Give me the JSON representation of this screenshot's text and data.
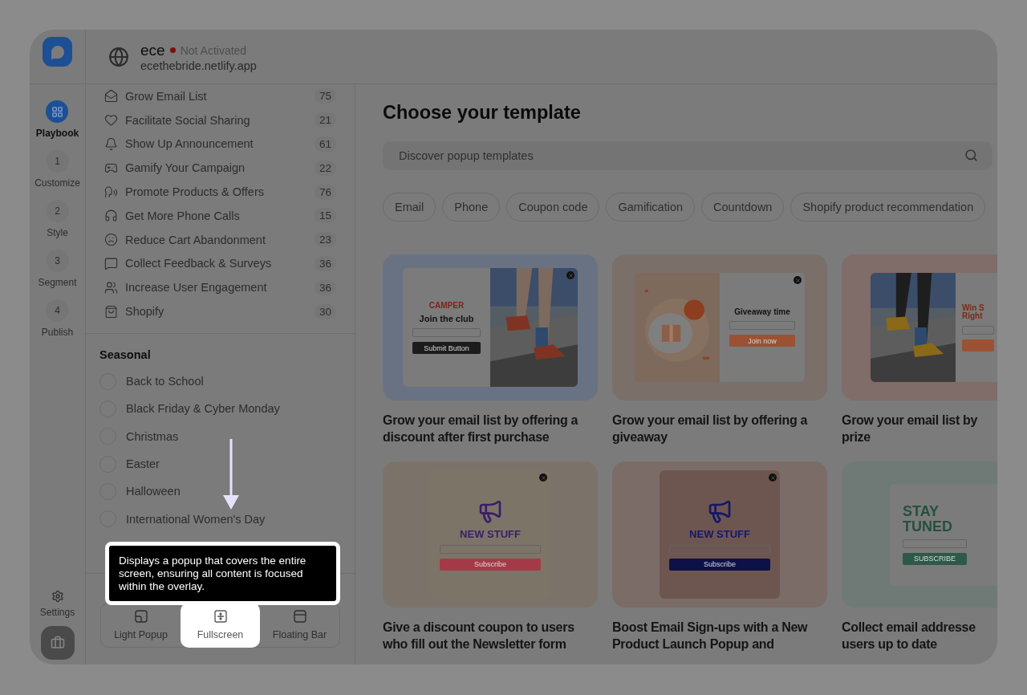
{
  "app": {
    "site_name": "ece",
    "status": "Not Activated",
    "domain": "ecethebride.netlify.app"
  },
  "rail": {
    "items": [
      {
        "kind": "icon",
        "label": "Playbook",
        "selected": true
      },
      {
        "kind": "step",
        "number": "1",
        "label": "Customize",
        "selected": false
      },
      {
        "kind": "step",
        "number": "2",
        "label": "Style",
        "selected": false
      },
      {
        "kind": "step",
        "number": "3",
        "label": "Segment",
        "selected": false
      },
      {
        "kind": "step",
        "number": "4",
        "label": "Publish",
        "selected": false
      }
    ],
    "settings": "Settings"
  },
  "goals": [
    {
      "label": "Grow Email List",
      "count": "75"
    },
    {
      "label": "Facilitate Social Sharing",
      "count": "21"
    },
    {
      "label": "Show Up Announcement",
      "count": "61"
    },
    {
      "label": "Gamify Your Campaign",
      "count": "22"
    },
    {
      "label": "Promote Products & Offers",
      "count": "76"
    },
    {
      "label": "Get More Phone Calls",
      "count": "15"
    },
    {
      "label": "Reduce Cart Abandonment",
      "count": "23"
    },
    {
      "label": "Collect Feedback & Surveys",
      "count": "36"
    },
    {
      "label": "Increase User Engagement",
      "count": "36"
    },
    {
      "label": "Shopify",
      "count": "30"
    }
  ],
  "seasonal": {
    "title": "Seasonal",
    "items": [
      {
        "label": "Back to School",
        "checked": false
      },
      {
        "label": "Black Friday & Cyber Monday",
        "checked": false
      },
      {
        "label": "Christmas",
        "checked": false
      },
      {
        "label": "Easter",
        "checked": false
      },
      {
        "label": "Halloween",
        "checked": false
      },
      {
        "label": "International Women's Day",
        "checked": false
      }
    ]
  },
  "popup_type": {
    "options": [
      {
        "label": "Light Popup",
        "selected": false
      },
      {
        "label": "Fullscreen",
        "selected": true
      },
      {
        "label": "Floating Bar",
        "selected": false
      }
    ]
  },
  "tooltip": "Displays a popup that covers the entire screen, ensuring all content is focused within the overlay.",
  "main": {
    "title": "Choose your template",
    "search": {
      "placeholder": "Discover popup templates"
    },
    "chips": [
      "Email",
      "Phone",
      "Coupon code",
      "Gamification",
      "Countdown",
      "Shopify product recommendation"
    ],
    "templates": [
      {
        "title": "Grow your email list by offering a\ndiscount after first purchase",
        "color": "#697282",
        "preview": {
          "kind": "photo-right",
          "brand": "CAMPER",
          "headline": "Join the club",
          "button": "Submit Button"
        }
      },
      {
        "title": "Grow your email list by offering a\ngiveaway",
        "color": "#7a6f69",
        "preview": {
          "kind": "photo-left",
          "headline": "Giveaway time",
          "button": "Join now"
        }
      },
      {
        "title": "Grow your email list by\nprize",
        "color": "#806c69",
        "preview": {
          "kind": "photo-left",
          "headline": "Win S\nRight"
        }
      },
      {
        "title": "Give a discount coupon to users\nwho fill out the Newsletter form",
        "color": "#7b7369",
        "preview": {
          "kind": "poster",
          "headline": "NEW STUFF",
          "button": "Subscribe"
        }
      },
      {
        "title": "Boost Email Sign-ups with a New\nProduct Launch Popup and",
        "color": "#7c6c67",
        "preview": {
          "kind": "poster",
          "headline": "NEW STUFF",
          "button": "Subscribe"
        }
      },
      {
        "title": "Collect email addresse\nusers up to date",
        "color": "#6f7a77",
        "preview": {
          "kind": "banner",
          "headline": "STAY\nTUNED",
          "button": "SUBSCRIBE"
        }
      }
    ]
  }
}
